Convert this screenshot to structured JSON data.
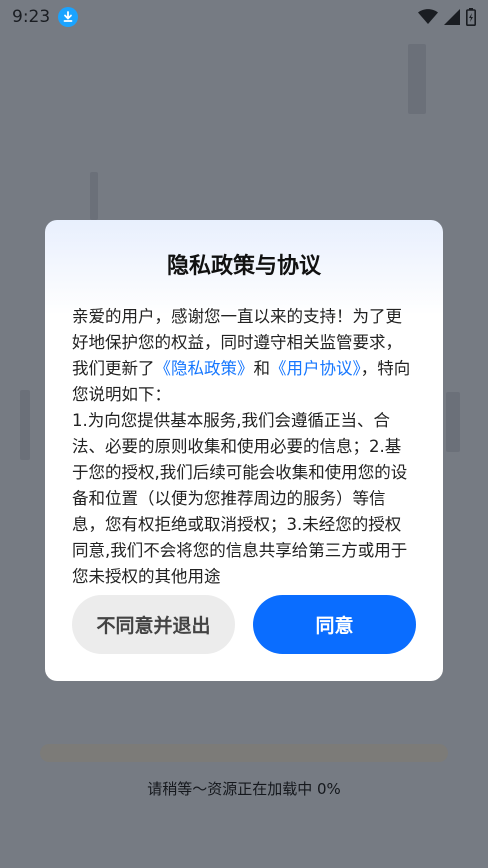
{
  "status_bar": {
    "time": "9:23",
    "icons": [
      "download-icon",
      "wifi-icon",
      "signal-icon",
      "battery-icon"
    ]
  },
  "dialog": {
    "title": "隐私政策与协议",
    "body": {
      "intro": "亲爱的用户，感谢您一直以来的支持！为了更好地保护您的权益，同时遵守相关监管要求，我们更新了",
      "privacy_link": "《隐私政策》",
      "and": "和",
      "agreement_link": "《用户协议》",
      "after_links": "，特向您说明如下：",
      "details": "1.为向您提供基本服务,我们会遵循正当、合法、必要的原则收集和使用必要的信息；2.基于您的授权,我们后续可能会收集和使用您的设备和位置（以便为您推荐周边的服务）等信息，您有权拒绝或取消授权；3.未经您的授权同意,我们不会将您的信息共享给第三方或用于您未授权的其他用途"
    },
    "disagree_label": "不同意并退出",
    "agree_label": "同意"
  },
  "loading": {
    "text": "请稍等～资源正在加载中 0%",
    "progress": 0
  },
  "colors": {
    "accent": "#0a6dff",
    "link": "#1677ff",
    "overlay": "#767b83"
  }
}
